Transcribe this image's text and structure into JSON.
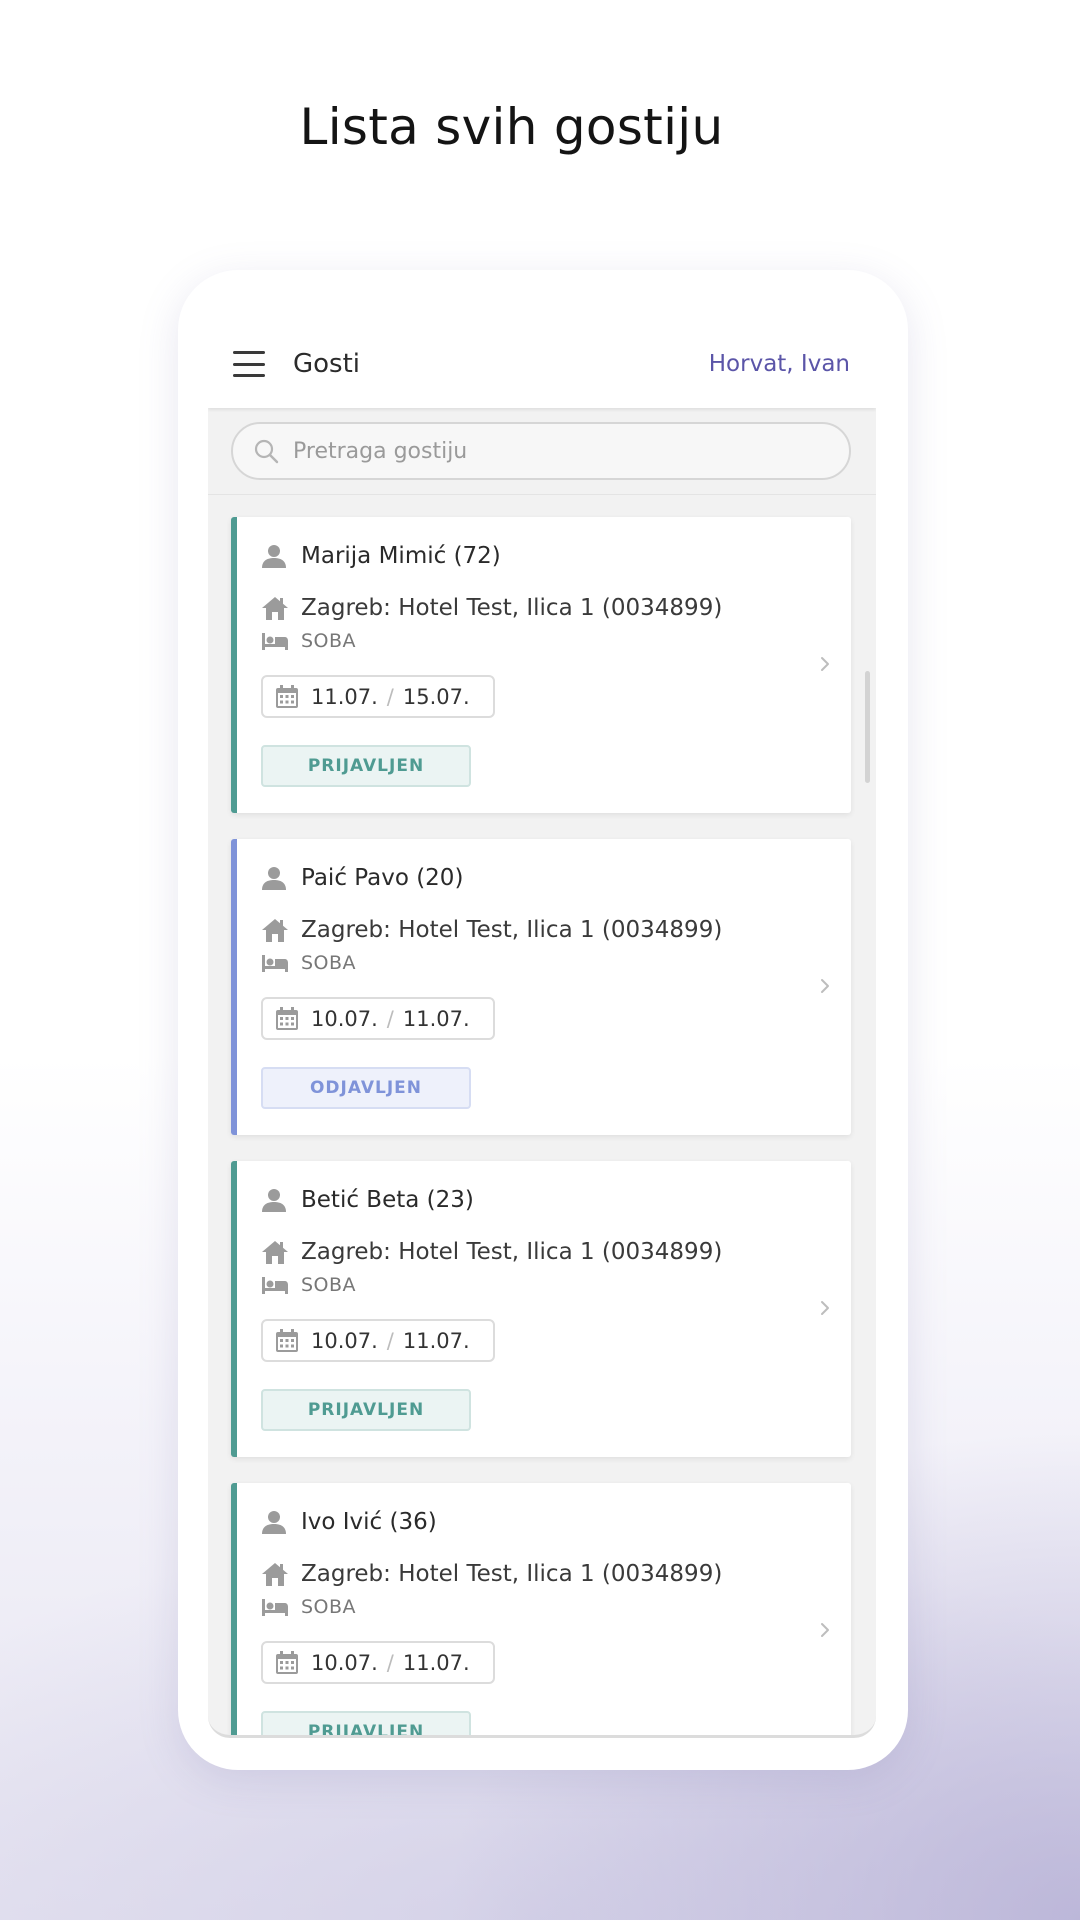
{
  "headline": "Lista svih gostiju",
  "appbar": {
    "title": "Gosti",
    "user": "Horvat, Ivan"
  },
  "search": {
    "placeholder": "Pretraga gostiju",
    "value": ""
  },
  "colors": {
    "accent": "#5b55a8",
    "checked_in": "#4f9b92",
    "checked_out": "#7f93d9"
  },
  "guests": [
    {
      "name": "Marija Mimić (72)",
      "location": "Zagreb: Hotel Test, Ilica 1 (0034899)",
      "room": "SOBA",
      "date_from": "11.07.",
      "date_sep": "/",
      "date_to": "15.07.",
      "status": "PRIJAVLJEN"
    },
    {
      "name": "Paić Pavo (20)",
      "location": "Zagreb: Hotel Test, Ilica 1 (0034899)",
      "room": "SOBA",
      "date_from": "10.07.",
      "date_sep": "/",
      "date_to": "11.07.",
      "status": "ODJAVLJEN"
    },
    {
      "name": "Betić Beta (23)",
      "location": "Zagreb: Hotel Test, Ilica 1 (0034899)",
      "room": "SOBA",
      "date_from": "10.07.",
      "date_sep": "/",
      "date_to": "11.07.",
      "status": "PRIJAVLJEN"
    },
    {
      "name": "Ivo Ivić (36)",
      "location": "Zagreb: Hotel Test, Ilica 1 (0034899)",
      "room": "SOBA",
      "date_from": "10.07.",
      "date_sep": "/",
      "date_to": "11.07.",
      "status": "PRIJAVLJEN"
    }
  ]
}
